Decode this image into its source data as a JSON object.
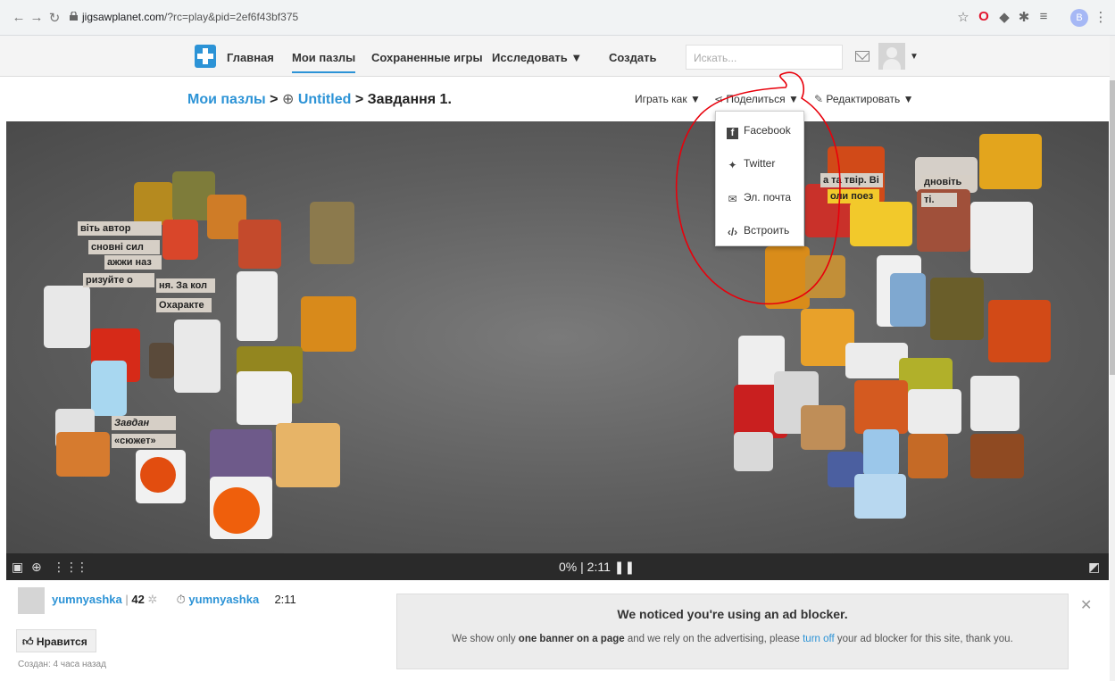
{
  "browser": {
    "url_host": "jigsawplanet.com",
    "url_path": "/?rc=play&pid=2ef6f43bf375",
    "profile_initial": "B"
  },
  "nav": {
    "items": [
      "Главная",
      "Мои пазлы",
      "Сохраненные игры",
      "Исследовать ▼",
      "Создать"
    ],
    "search_placeholder": "Искать..."
  },
  "breadcrumb": {
    "root": "Мои пазлы",
    "sep": ">",
    "folder": "Untitled",
    "title": "Завдання 1."
  },
  "toolbar": {
    "play_as": "Играть как",
    "share": "Поделиться",
    "edit": "Редактировать"
  },
  "share_menu": {
    "items": [
      "Facebook",
      "Twitter",
      "Эл. почта",
      "Встроить"
    ]
  },
  "puzzle_texts": {
    "t1": "віть автор",
    "t2": "сновні сил",
    "t3": "ажжи наз",
    "t4": "ризуйте о",
    "t5": "ня. За кол",
    "t6": "Охаракте",
    "t7": "Завдан",
    "t8": "«сюжет»",
    "t9": "а та твір. Ві",
    "t10": "оли поез",
    "t11": "дновіть",
    "t12": "ті."
  },
  "status": {
    "progress": "0%",
    "time": "2:11"
  },
  "author": {
    "name": "yumnyashka",
    "count": "42",
    "best_name": "yumnyashka",
    "best_time": "2:11",
    "like_label": "Нравится",
    "created_label": "Создан:",
    "created_value": "4 часа назад"
  },
  "ad_notice": {
    "title": "We noticed you're using an ad blocker.",
    "text_1": "We show only ",
    "text_bold": "one banner on a page",
    "text_2": " and we rely on the advertising, please ",
    "link": "turn off",
    "text_3": " your ad blocker for this site, thank you."
  },
  "colors": {
    "accent": "#2c93d6",
    "annotation": "#e8000b"
  }
}
